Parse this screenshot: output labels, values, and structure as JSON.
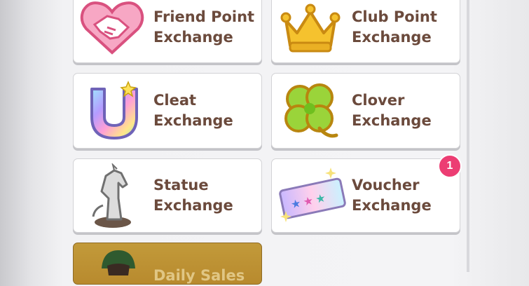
{
  "exchange_menu": {
    "items": [
      {
        "label_line1": "Friend Point",
        "label_line2": "Exchange",
        "icon": "handshake-icon"
      },
      {
        "label_line1": "Club Point",
        "label_line2": "Exchange",
        "icon": "crown-icon"
      },
      {
        "label_line1": "Cleat",
        "label_line2": "Exchange",
        "icon": "horseshoe-icon"
      },
      {
        "label_line1": "Clover",
        "label_line2": "Exchange",
        "icon": "clover-icon"
      },
      {
        "label_line1": "Statue",
        "label_line2": "Exchange",
        "icon": "horse-statue-icon"
      },
      {
        "label_line1": "Voucher",
        "label_line2": "Exchange",
        "icon": "voucher-ticket-icon",
        "badge": "1"
      }
    ],
    "daily_sales": {
      "label": "Daily Sales",
      "icon": "character-avatar-icon"
    }
  },
  "colors": {
    "label_text": "#6b4a3c",
    "badge": "#ec3d73",
    "daily_sales_bg": "#c29a3a"
  }
}
